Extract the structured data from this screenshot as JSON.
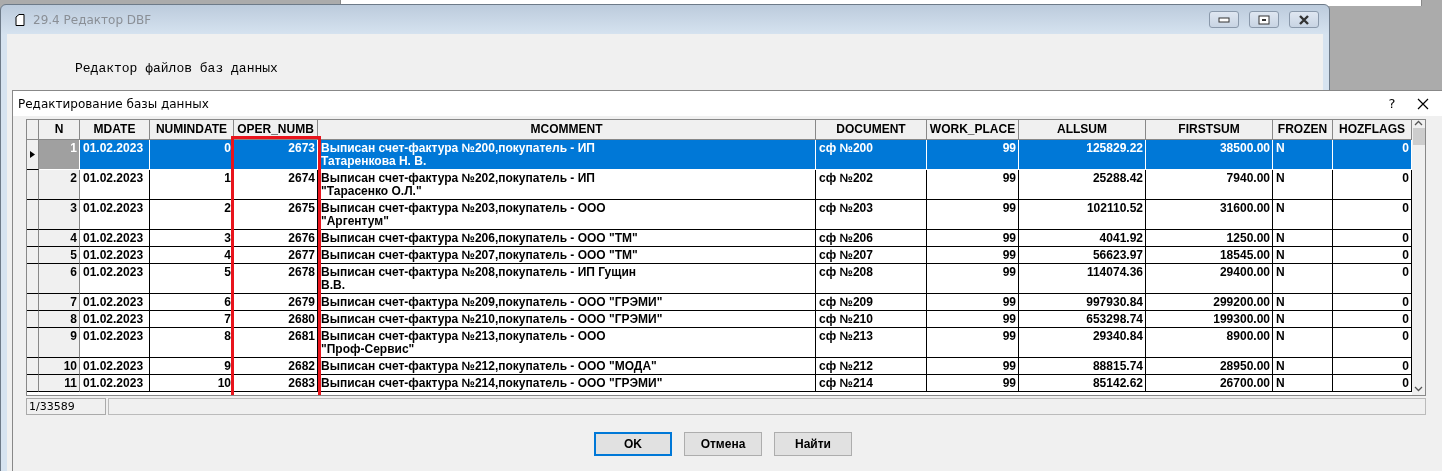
{
  "window": {
    "title": "29.4 Редактор DBF",
    "heading": "Редактор файлов баз данных"
  },
  "dialog": {
    "title": "Редактирование базы данных",
    "help": "?"
  },
  "table": {
    "columns": [
      "N",
      "MDATE",
      "NUMINDATE",
      "OPER_NUMB",
      "MCOMMENT",
      "DOCUMENT",
      "WORK_PLACE",
      "ALLSUM",
      "FIRSTSUM",
      "FROZEN",
      "HOZFLAGS"
    ],
    "rows": [
      {
        "selected": true,
        "cells": [
          "1",
          "01.02.2023",
          "0",
          "2673",
          "Выписан счет-фактура №200,покупатель - ИП\nТатаренкова Н. В.",
          "сф №200",
          "99",
          "125829.22",
          "38500.00",
          "N",
          "0"
        ]
      },
      {
        "selected": false,
        "cells": [
          "2",
          "01.02.2023",
          "1",
          "2674",
          "Выписан счет-фактура №202,покупатель - ИП\n\"Тарасенко О.Л.\"",
          "сф №202",
          "99",
          "25288.42",
          "7940.00",
          "N",
          "0"
        ]
      },
      {
        "selected": false,
        "cells": [
          "3",
          "01.02.2023",
          "2",
          "2675",
          "Выписан счет-фактура №203,покупатель - ООО\n\"Аргентум\"",
          "сф №203",
          "99",
          "102110.52",
          "31600.00",
          "N",
          "0"
        ]
      },
      {
        "selected": false,
        "cells": [
          "4",
          "01.02.2023",
          "3",
          "2676",
          "Выписан счет-фактура №206,покупатель - ООО \"ТМ\"",
          "сф №206",
          "99",
          "4041.92",
          "1250.00",
          "N",
          "0"
        ]
      },
      {
        "selected": false,
        "cells": [
          "5",
          "01.02.2023",
          "4",
          "2677",
          "Выписан счет-фактура №207,покупатель - ООО \"ТМ\"",
          "сф №207",
          "99",
          "56623.97",
          "18545.00",
          "N",
          "0"
        ]
      },
      {
        "selected": false,
        "cells": [
          "6",
          "01.02.2023",
          "5",
          "2678",
          "Выписан счет-фактура №208,покупатель - ИП Гущин\nВ.В.",
          "сф №208",
          "99",
          "114074.36",
          "29400.00",
          "N",
          "0"
        ]
      },
      {
        "selected": false,
        "cells": [
          "7",
          "01.02.2023",
          "6",
          "2679",
          "Выписан счет-фактура №209,покупатель - ООО \"ГРЭМИ\"",
          "сф №209",
          "99",
          "997930.84",
          "299200.00",
          "N",
          "0"
        ]
      },
      {
        "selected": false,
        "cells": [
          "8",
          "01.02.2023",
          "7",
          "2680",
          "Выписан счет-фактура №210,покупатель - ООО \"ГРЭМИ\"",
          "сф №210",
          "99",
          "653298.74",
          "199300.00",
          "N",
          "0"
        ]
      },
      {
        "selected": false,
        "cells": [
          "9",
          "01.02.2023",
          "8",
          "2681",
          "Выписан счет-фактура №213,покупатель - ООО\n\"Проф-Сервис\"",
          "сф №213",
          "99",
          "29340.84",
          "8900.00",
          "N",
          "0"
        ]
      },
      {
        "selected": false,
        "cells": [
          "10",
          "01.02.2023",
          "9",
          "2682",
          "Выписан счет-фактура №212,покупатель - ООО \"МОДА\"",
          "сф №212",
          "99",
          "88815.74",
          "28950.00",
          "N",
          "0"
        ]
      },
      {
        "selected": false,
        "cells": [
          "11",
          "01.02.2023",
          "10",
          "2683",
          "Выписан счет-фактура №214,покупатель - ООО \"ГРЭМИ\"",
          "сф №214",
          "99",
          "85142.62",
          "26700.00",
          "N",
          "0"
        ]
      }
    ]
  },
  "status": "1/33589",
  "buttons": [
    {
      "label": "OK",
      "selected": true
    },
    {
      "label": "Отмена",
      "selected": false
    },
    {
      "label": "Найти",
      "selected": false
    }
  ]
}
